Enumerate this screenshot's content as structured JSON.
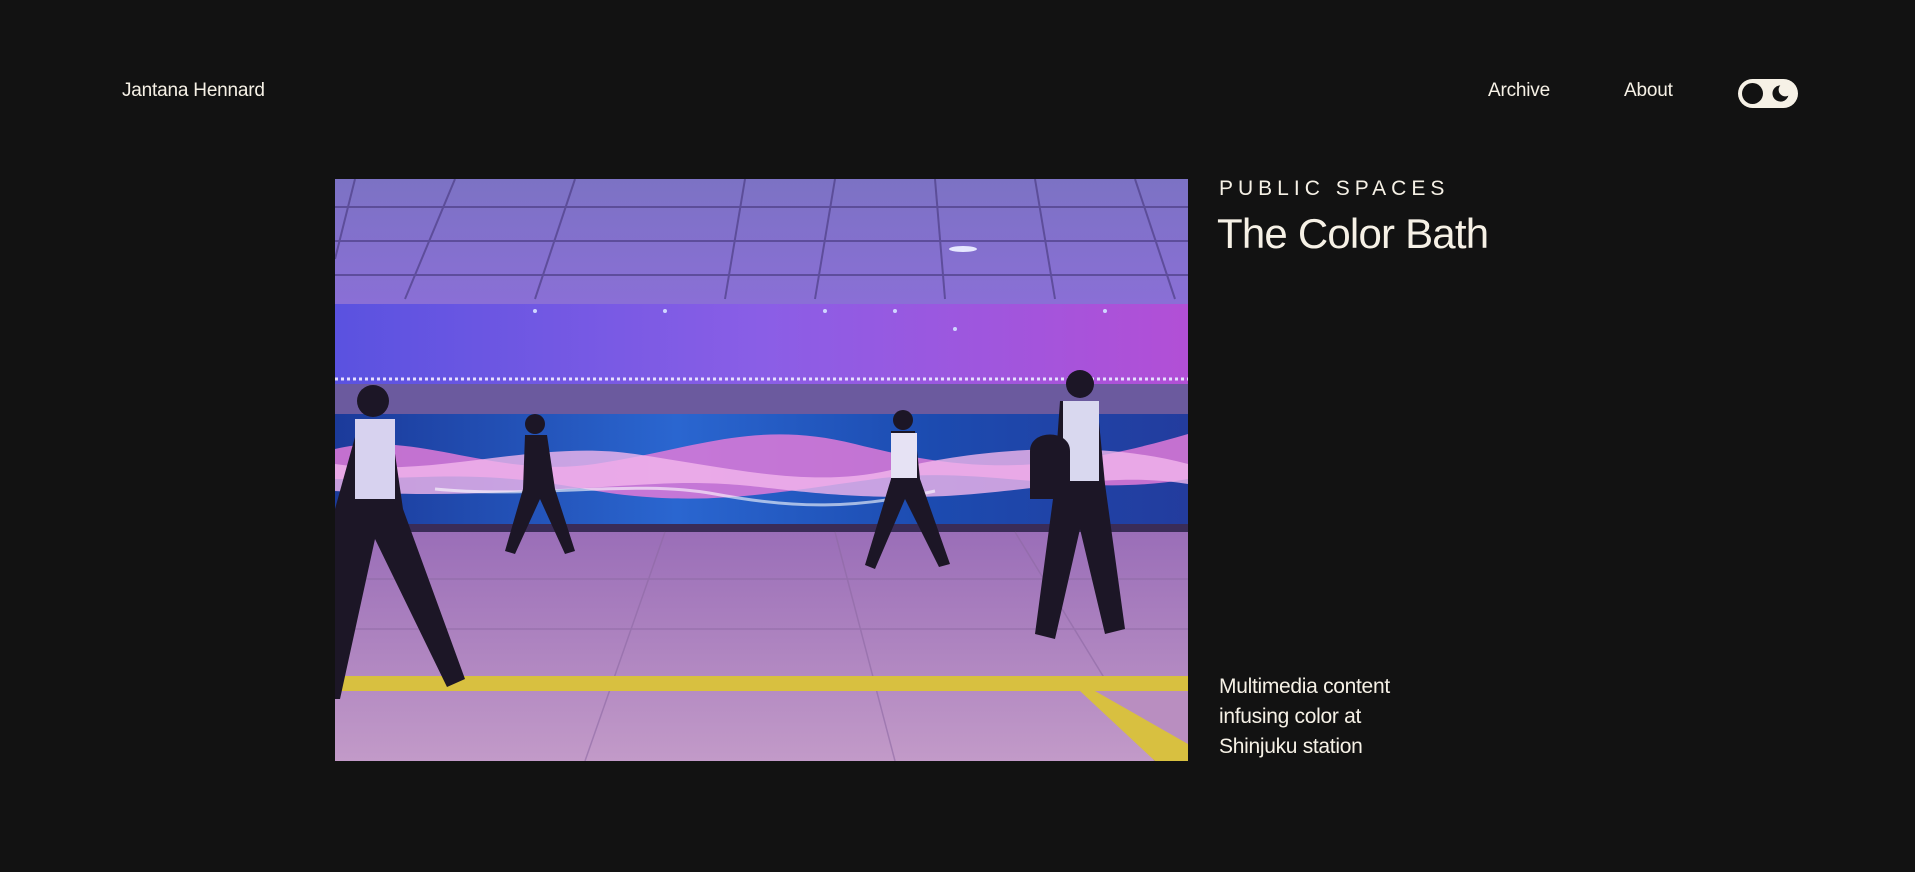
{
  "header": {
    "site_name": "Jantana Hennard",
    "nav": {
      "archive": "Archive",
      "about": "About"
    },
    "theme_toggle": {
      "icons": [
        "circle-knob-icon",
        "moon-icon"
      ]
    }
  },
  "project": {
    "category": "PUBLIC SPACES",
    "title": "The Color Bath",
    "description_lines": [
      "Multimedia content",
      "infusing color at",
      "Shinjuku station"
    ]
  },
  "colors": {
    "background": "#121212",
    "text": "#f6f1e6"
  }
}
